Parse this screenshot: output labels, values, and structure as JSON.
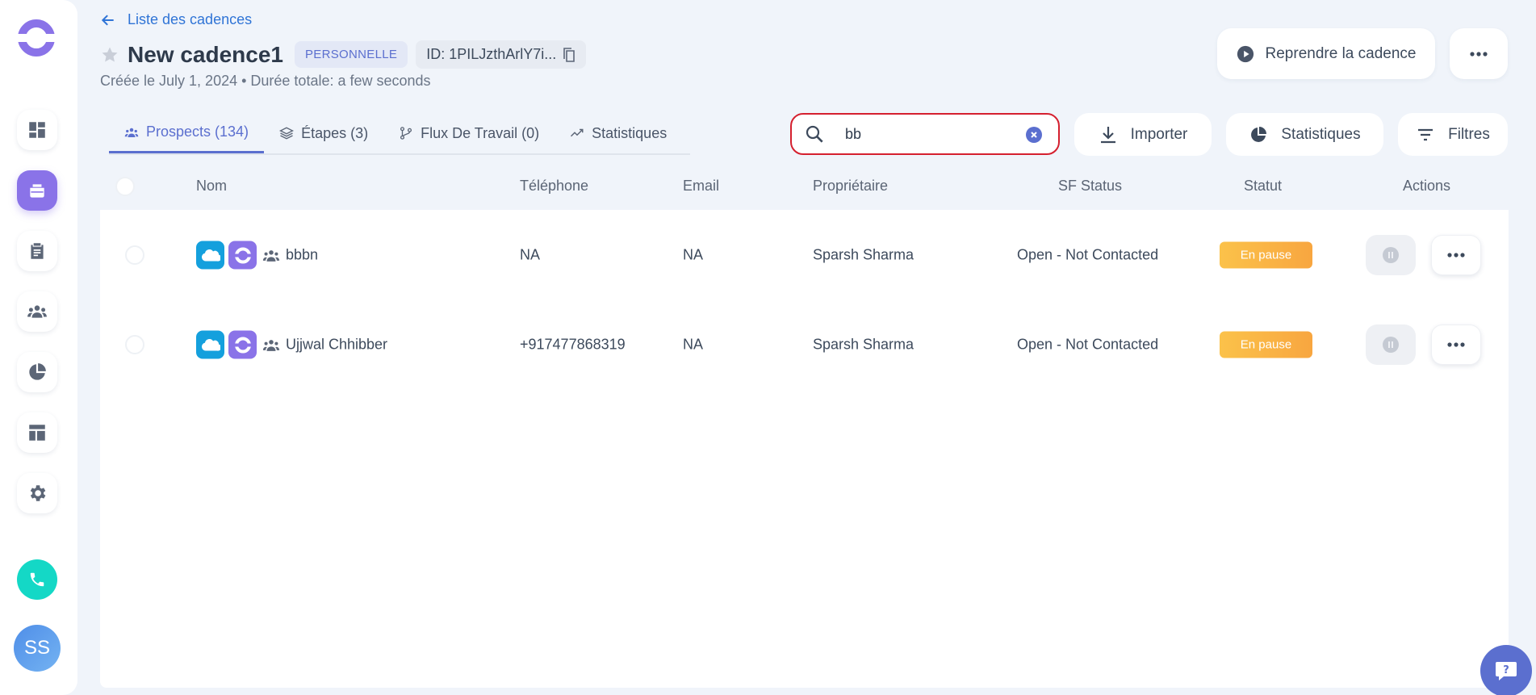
{
  "nav": {
    "back_label": "Liste des cadences"
  },
  "header": {
    "title": "New cadence1",
    "type_badge": "PERSONNELLE",
    "id_label": "ID: 1PILJzthArlY7i...",
    "subtitle": "Créée le July 1, 2024 • Durée totale: a few seconds",
    "resume_label": "Reprendre la cadence"
  },
  "tabs": [
    {
      "label": "Prospects (134)",
      "icon": "users-icon",
      "active": true
    },
    {
      "label": "Étapes (3)",
      "icon": "layers-icon",
      "active": false
    },
    {
      "label": "Flux De Travail (0)",
      "icon": "workflow-icon",
      "active": false
    },
    {
      "label": "Statistiques",
      "icon": "trend-icon",
      "active": false
    }
  ],
  "toolbar": {
    "search_value": "bb",
    "import_label": "Importer",
    "stats_label": "Statistiques",
    "filters_label": "Filtres"
  },
  "table": {
    "columns": [
      "Nom",
      "Téléphone",
      "Email",
      "Propriétaire",
      "SF Status",
      "Statut",
      "Actions"
    ],
    "rows": [
      {
        "name": "bbbn",
        "phone": "NA",
        "email": "NA",
        "owner": "Sparsh Sharma",
        "sf_status": "Open - Not Contacted",
        "status": "En pause"
      },
      {
        "name": "Ujjwal Chhibber",
        "phone": "+917477868319",
        "email": "NA",
        "owner": "Sparsh Sharma",
        "sf_status": "Open - Not Contacted",
        "status": "En pause"
      }
    ]
  },
  "user": {
    "initials": "SS"
  },
  "colors": {
    "accent": "#5b6fcf",
    "brand": "#8a73e8",
    "paused": "#f8a640",
    "search_border": "#d5202f"
  }
}
